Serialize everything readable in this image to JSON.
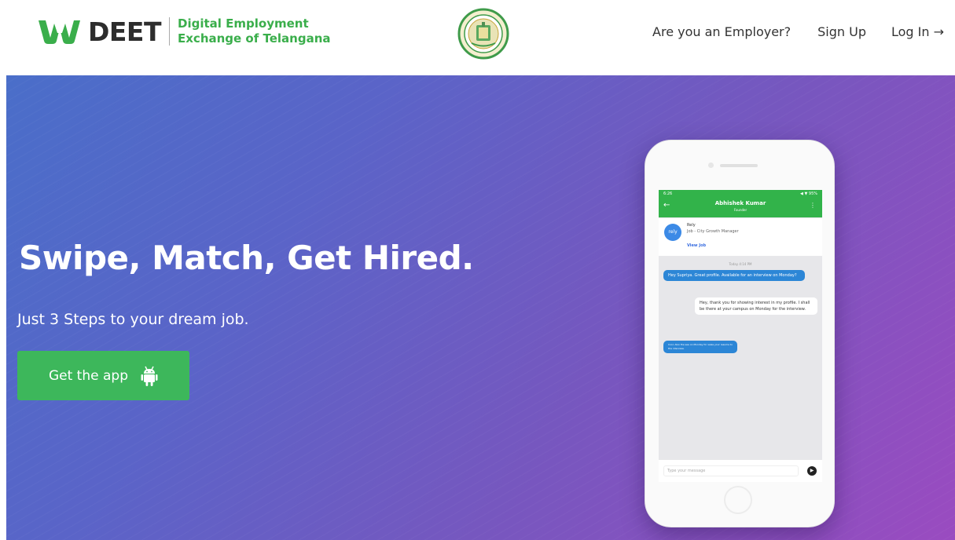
{
  "header": {
    "brand": "DEET",
    "brand_sub_line1": "Digital Employment",
    "brand_sub_line2": "Exchange of Telangana",
    "emblem_icon": "telangana-emblem-icon",
    "nav": {
      "employer": "Are you an Employer?",
      "signup": "Sign Up",
      "login": "Log In →"
    }
  },
  "hero": {
    "headline": "Swipe, Match, Get Hired.",
    "subline": "Just 3 Steps to your dream job.",
    "cta_label": "Get the app",
    "cta_icon": "android-icon"
  },
  "phone": {
    "status_time": "6:26",
    "status_right": "◀ ▼ 95%",
    "contact_name": "Abhishek Kumar",
    "contact_role": "Founder",
    "job_company": "Rely",
    "job_title": "Job - City Growth Manager",
    "job_view": "View Job",
    "company_logo_text": "rely",
    "date_chip": "Today 4:14 PM",
    "msg1": "Hey Supriya. Great profile. Available for an interview on Monday?",
    "msg2": "Hey, thank you for showing interest in my profile. I shall be there at your campus on Monday for the interview.",
    "msg3": "Cool. Also the see on Monday for sales your resume to the interview.",
    "input_placeholder": "Type your message"
  },
  "colors": {
    "brand_green": "#3aae4b",
    "cta_green": "#3db75b",
    "hero_gradient_start": "#4a6ec9",
    "hero_gradient_end": "#9a4bc0"
  }
}
